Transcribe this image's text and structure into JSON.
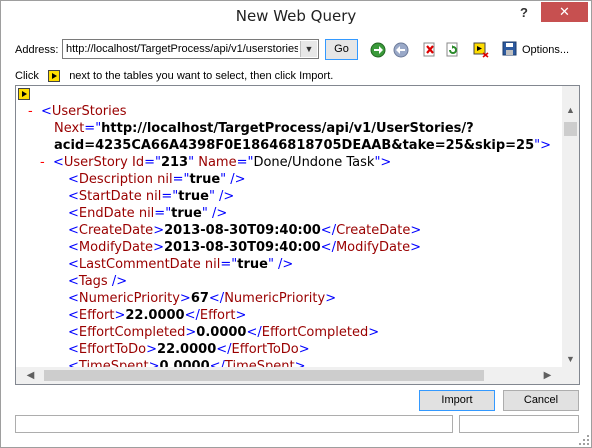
{
  "window": {
    "title": "New Web Query",
    "help": "?",
    "close": "✕"
  },
  "toolbar": {
    "address_label": "Address:",
    "address_value": "http://localhost/TargetProcess/api/v1/userstories",
    "go_label": "Go",
    "options_label": "Options..."
  },
  "instructions": {
    "before": "Click",
    "after": "next to the tables you want to select, then click Import."
  },
  "xml": {
    "root_tag": "UserStories",
    "next_attr": "Next",
    "next_value_1": "http://localhost/TargetProcess/api/v1/UserStories/?",
    "next_value_2": "acid=4235CA66A4398F0E18646818705DEAAB&take=25&skip=25",
    "story_tag": "UserStory",
    "id_attr": "Id",
    "id_value": "213",
    "name_attr": "Name",
    "name_value": "Done/Undone Task",
    "nil_attr": "nil",
    "nil_value": "true",
    "description_tag": "Description",
    "startdate_tag": "StartDate",
    "enddate_tag": "EndDate",
    "createdate_tag": "CreateDate",
    "createdate_value": "2013-08-30T09:40:00",
    "modifydate_tag": "ModifyDate",
    "modifydate_value": "2013-08-30T09:40:00",
    "lastcomment_tag": "LastCommentDate",
    "tags_tag": "Tags",
    "priority_tag": "NumericPriority",
    "priority_value": "67",
    "effort_tag": "Effort",
    "effort_value": "22.0000",
    "effortcompleted_tag": "EffortCompleted",
    "effortcompleted_value": "0.0000",
    "efforttodo_tag": "EffortToDo",
    "efforttodo_value": "22.0000",
    "timespent_tag": "TimeSpent",
    "timespent_value": "0.0000"
  },
  "buttons": {
    "import": "Import",
    "cancel": "Cancel"
  },
  "icons": [
    "forward-icon",
    "back-icon",
    "stop-icon",
    "refresh-icon",
    "show-icons-icon",
    "save-query-icon"
  ],
  "colors": {
    "tag": "#990000",
    "bracket": "#0000ff",
    "dash": "#ff0000",
    "close": "#c75050",
    "marker": "#ffdd00"
  }
}
